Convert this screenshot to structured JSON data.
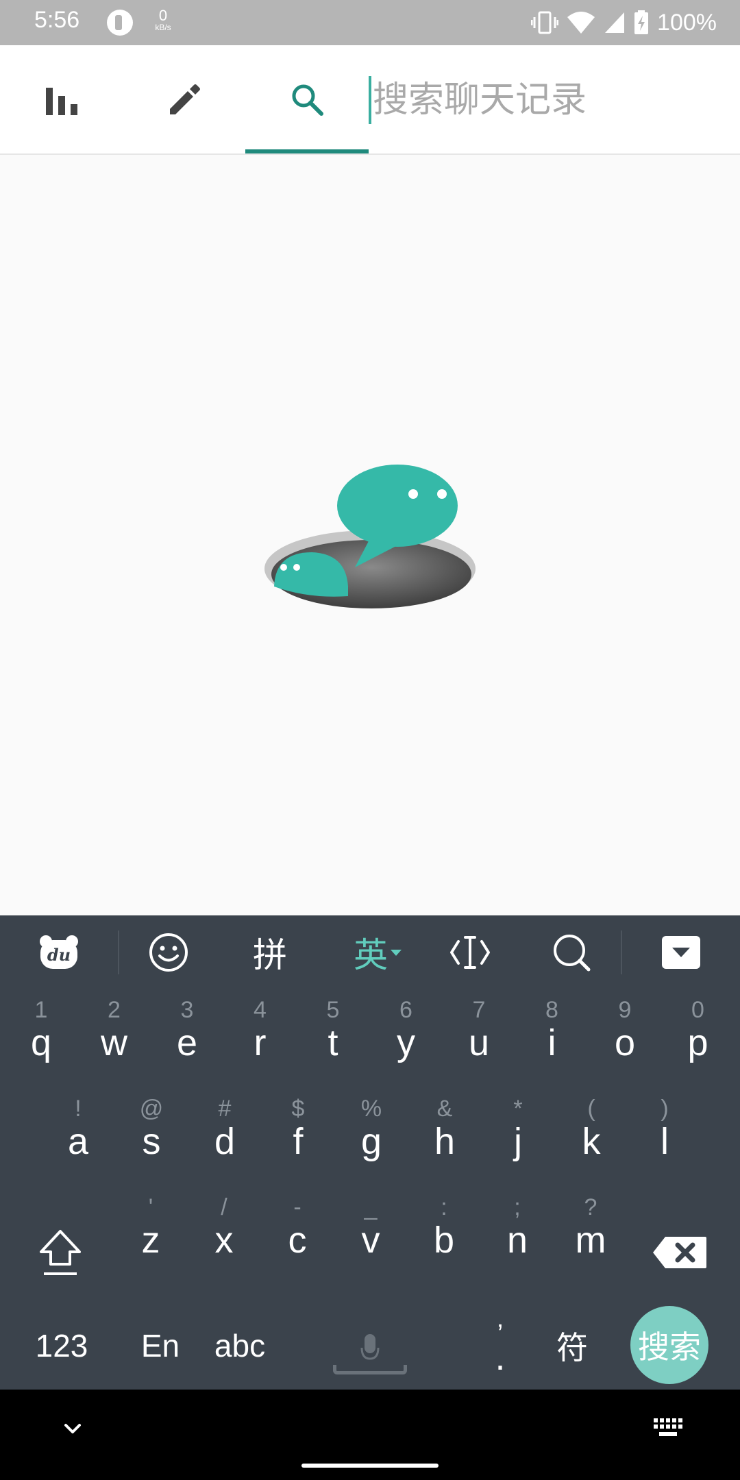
{
  "status_bar": {
    "time": "5:56",
    "net_speed_value": "0",
    "net_speed_unit": "kB/s",
    "battery_text": "100%",
    "icons": [
      "app-notification-icon",
      "vibrate-icon",
      "wifi-icon",
      "cellular-signal-icon",
      "battery-charging-icon"
    ]
  },
  "tabs": [
    {
      "name": "stats",
      "icon": "bar-chart-icon"
    },
    {
      "name": "edit",
      "icon": "pencil-icon"
    },
    {
      "name": "search",
      "icon": "search-icon",
      "active": true
    }
  ],
  "search": {
    "placeholder": "搜索聊天记录",
    "value": ""
  },
  "colors": {
    "accent": "#1f8a7c",
    "illustration": "#35b9a8",
    "keyboard_bg": "#3b434c",
    "keyboard_active": "#61cdbd",
    "go_button": "#7ecfc3"
  },
  "keyboard": {
    "toolbar": {
      "pinyin_label": "拼",
      "english_label": "英",
      "icons": [
        "du-logo-icon",
        "emoji-icon",
        "cursor-icon",
        "search-icon",
        "hide-keyboard-icon"
      ]
    },
    "row1": [
      {
        "alt": "1",
        "key": "q"
      },
      {
        "alt": "2",
        "key": "w"
      },
      {
        "alt": "3",
        "key": "e"
      },
      {
        "alt": "4",
        "key": "r"
      },
      {
        "alt": "5",
        "key": "t"
      },
      {
        "alt": "6",
        "key": "y"
      },
      {
        "alt": "7",
        "key": "u"
      },
      {
        "alt": "8",
        "key": "i"
      },
      {
        "alt": "9",
        "key": "o"
      },
      {
        "alt": "0",
        "key": "p"
      }
    ],
    "row2": [
      {
        "alt": "!",
        "key": "a"
      },
      {
        "alt": "@",
        "key": "s"
      },
      {
        "alt": "#",
        "key": "d"
      },
      {
        "alt": "$",
        "key": "f"
      },
      {
        "alt": "%",
        "key": "g"
      },
      {
        "alt": "&",
        "key": "h"
      },
      {
        "alt": "*",
        "key": "j"
      },
      {
        "alt": "(",
        "key": "k"
      },
      {
        "alt": ")",
        "key": "l"
      }
    ],
    "row3": [
      {
        "alt": "'",
        "key": "z"
      },
      {
        "alt": "/",
        "key": "x"
      },
      {
        "alt": "-",
        "key": "c"
      },
      {
        "alt": "_",
        "key": "v"
      },
      {
        "alt": ":",
        "key": "b"
      },
      {
        "alt": ";",
        "key": "n"
      },
      {
        "alt": "?",
        "key": "m"
      }
    ],
    "bottom": {
      "numbers_label": "123",
      "lang_label": "En",
      "abc_label": "abc",
      "punct_alt": "’",
      "punct_label": ".",
      "symbols_label": "符",
      "go_label": "搜索"
    }
  }
}
